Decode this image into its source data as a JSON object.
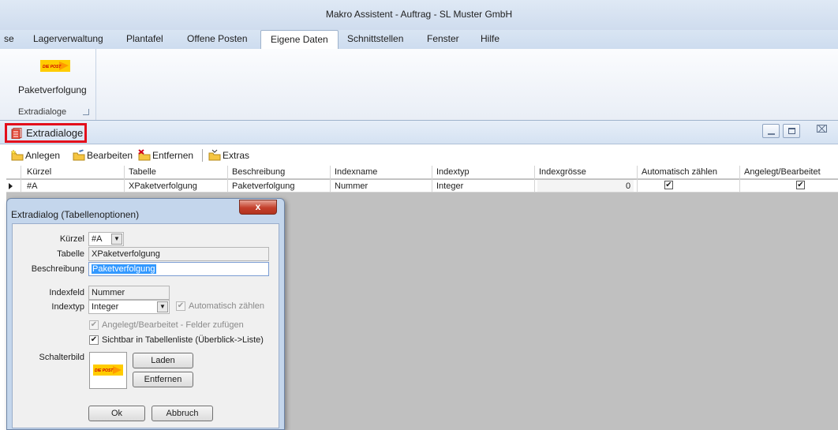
{
  "window": {
    "title": "Makro Assistent - Auftrag - SL Muster GmbH"
  },
  "menu": {
    "tabs": [
      "se",
      "Lagerverwaltung",
      "Plantafel",
      "Offene Posten",
      "Eigene Daten",
      "Schnittstellen",
      "Fenster",
      "Hilfe"
    ],
    "active": "Eigene Daten"
  },
  "ribbon": {
    "button_label": "Paketverfolgung",
    "logo_text": "DIE POST",
    "group_label": "Extradialoge"
  },
  "mdi": {
    "title": "Extradialoge"
  },
  "toolbar": {
    "anlegen": "Anlegen",
    "bearbeiten": "Bearbeiten",
    "entfernen": "Entfernen",
    "extras": "Extras"
  },
  "grid": {
    "headers": [
      "Kürzel",
      "Tabelle",
      "Beschreibung",
      "Indexname",
      "Indextyp",
      "Indexgrösse",
      "Automatisch zählen",
      "Angelegt/Bearbeitet"
    ],
    "rows": [
      {
        "kuerzel": "#A",
        "tabelle": "XPaketverfolgung",
        "beschreibung": "Paketverfolgung",
        "indexname": "Nummer",
        "indextyp": "Integer",
        "indexgroesse": "0",
        "automatisch_zaehlen": true,
        "angelegt_bearbeitet": true
      }
    ]
  },
  "dialog": {
    "title": "Extradialog (Tabellenoptionen)",
    "close": "x",
    "labels": {
      "kuerzel": "Kürzel",
      "tabelle": "Tabelle",
      "beschreibung": "Beschreibung",
      "indexfeld": "Indexfeld",
      "indextyp": "Indextyp",
      "schalterbild": "Schalterbild"
    },
    "values": {
      "kuerzel": "#A",
      "tabelle": "XPaketverfolgung",
      "beschreibung": "Paketverfolgung",
      "indexfeld": "Nummer",
      "indextyp": "Integer"
    },
    "checkboxes": {
      "automatisch_zaehlen": "Automatisch zählen",
      "angelegt": "Angelegt/Bearbeitet - Felder zufügen",
      "sichtbar": "Sichtbar in Tabellenliste (Überblick->Liste)"
    },
    "image_logo_text": "DIE POST",
    "buttons": {
      "laden": "Laden",
      "entfernen": "Entfernen",
      "ok": "Ok",
      "abbruch": "Abbruch"
    }
  },
  "colors": {
    "highlight_border": "#e30d1b",
    "post_yellow": "#ffcc00",
    "grid_background": "#c0c0c0"
  }
}
